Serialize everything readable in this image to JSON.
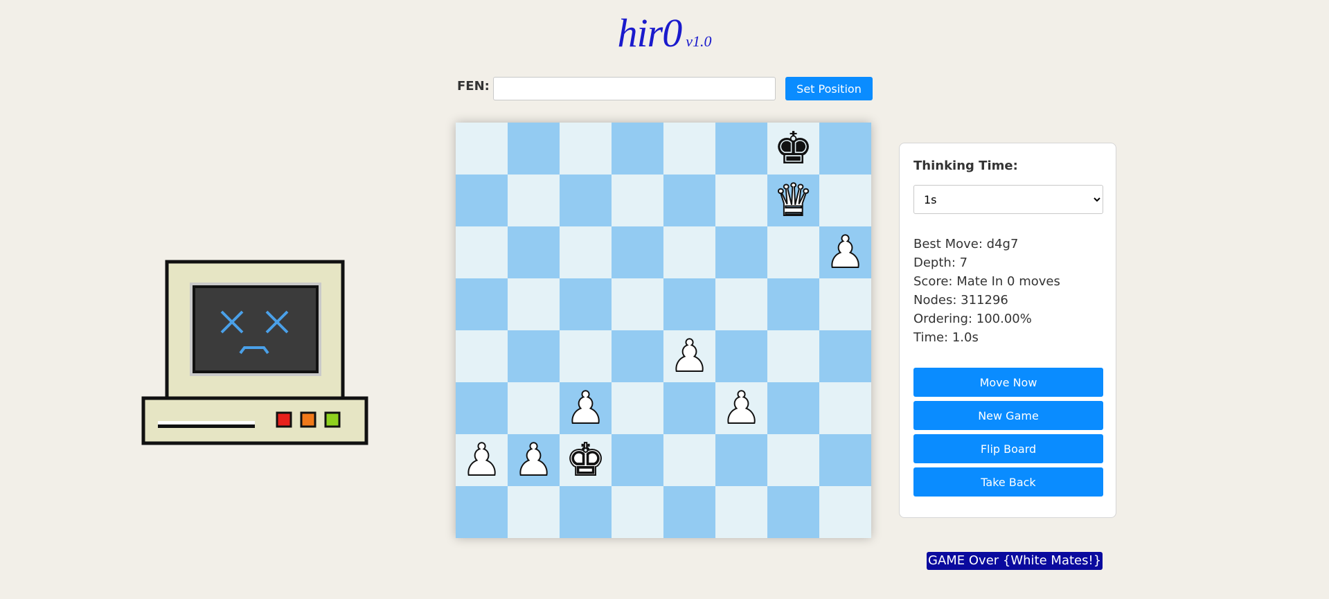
{
  "header": {
    "name": "hir0",
    "version": "v1.0"
  },
  "fen": {
    "label": "FEN:",
    "value": "",
    "button_label": "Set Position"
  },
  "colors": {
    "accent": "#0a8cff",
    "title": "#1a1acc",
    "board_light": "#e4f2f7",
    "board_dark": "#93cbf2",
    "status_bg": "#0a0a9e",
    "background": "#f2efe8"
  },
  "board": {
    "ranks": [
      [
        "",
        "",
        "",
        "",
        "",
        "",
        "bK",
        ""
      ],
      [
        "",
        "",
        "",
        "",
        "",
        "",
        "wQ",
        ""
      ],
      [
        "",
        "",
        "",
        "",
        "",
        "",
        "",
        "wP"
      ],
      [
        "",
        "",
        "",
        "",
        "",
        "",
        "",
        ""
      ],
      [
        "",
        "",
        "",
        "",
        "wP",
        "",
        "",
        ""
      ],
      [
        "",
        "",
        "wP",
        "",
        "",
        "wP",
        "",
        ""
      ],
      [
        "wP",
        "wP",
        "wK",
        "",
        "",
        "",
        "",
        ""
      ],
      [
        "",
        "",
        "",
        "",
        "",
        "",
        "",
        ""
      ]
    ]
  },
  "panel": {
    "thinking_label": "Thinking Time:",
    "thinking_value": "1s",
    "stats": {
      "best_move": "Best Move: d4g7",
      "depth": "Depth: 7",
      "score": "Score: Mate In 0 moves",
      "nodes": "Nodes: 311296",
      "ordering": "Ordering: 100.00%",
      "time": "Time: 1.0s"
    },
    "buttons": {
      "move_now": "Move Now",
      "new_game": "New Game",
      "flip_board": "Flip Board",
      "take_back": "Take Back"
    }
  },
  "status": "GAME Over {White Mates!}",
  "mascot": {
    "icon": "sad-computer-icon"
  }
}
